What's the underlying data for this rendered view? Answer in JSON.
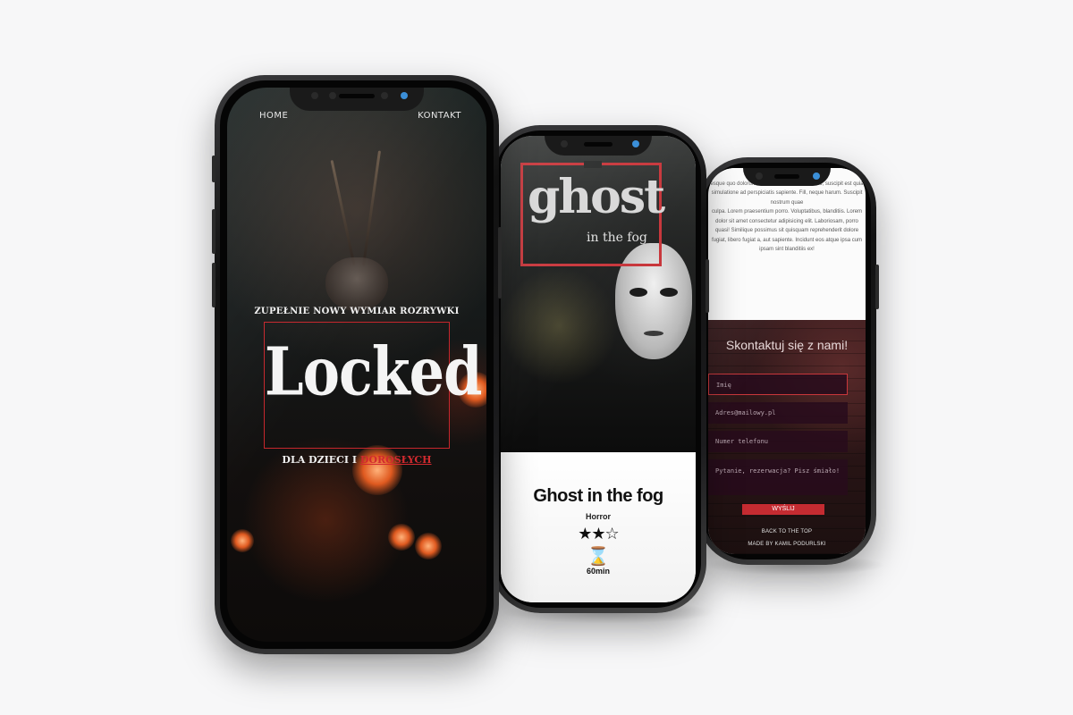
{
  "phone1": {
    "nav": {
      "home": "HOME",
      "contact": "KONTAKT"
    },
    "tagline": "ZUPEŁNIE NOWY WYMIAR ROZRYWKI",
    "logo": "Locked",
    "sub_prefix": "DLA DZIECI I ",
    "sub_highlight": "DOROSŁYCH"
  },
  "phone2": {
    "poster_title": "ghost",
    "poster_subtitle": "in the fog",
    "room_name": "Ghost in the fog",
    "genre": "Horror",
    "stars": "★★☆",
    "rating_value": 2,
    "rating_max": 3,
    "duration_icon": "hourglass-icon",
    "duration_glyph": "⌛",
    "duration": "60min"
  },
  "phone3": {
    "lorem": "Culpa nihil\nesque quo dolorum nostrum cum ad exercitatio, suscipit est quia\nsimulatione ad perspiciatis sapiente. Fill, neque harum. Suscipit nostrum quae\nculpa. Lorem praesentium porro. Voluptatibus, blanditiis. Lorem\ndolor sit amet consectetur adipisicing elit. Laboriosam, porro\nquasi! Similique possimus sit quisquam reprehenderit dolore\nfugiat, libero fugiat a, aut sapiente. Incidunt eos atque ipsa cum\nipsam sint blanditiis ex!",
    "heading": "Skontaktuj się z nami!",
    "fields": {
      "name": "Imię",
      "email": "Adres@mailowy.pl",
      "phone": "Numer telefonu",
      "message": "Pytanie, rezerwacja? Pisz śmiało!"
    },
    "send_label": "WYŚLIJ",
    "back_to_top": "BACK TO THE TOP",
    "made_by": "MADE BY KAMIL PODURLSKI"
  },
  "colors": {
    "accent_red": "#c6262c",
    "background": "#f7f7f8",
    "phone_body": "#1c1c1e"
  }
}
